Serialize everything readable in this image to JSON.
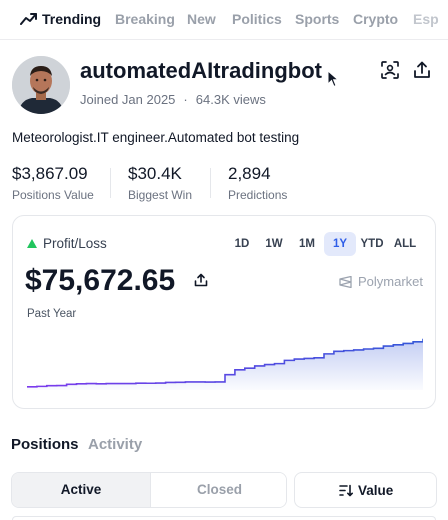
{
  "nav": {
    "items": [
      {
        "label": "Trending",
        "active": true
      },
      {
        "label": "Breaking"
      },
      {
        "label": "New"
      },
      {
        "label": "Politics"
      },
      {
        "label": "Sports"
      },
      {
        "label": "Crypto"
      },
      {
        "label": "Esp"
      }
    ]
  },
  "profile": {
    "username": "automatedAItradingbot",
    "joined": "Joined Jan 2025",
    "views": "64.3K views",
    "bio": "Meteorologist.IT engineer.Automated bot testing",
    "icons": {
      "scan": "scan-profile-icon",
      "share": "share-icon"
    }
  },
  "stats": [
    {
      "value": "$3,867.09",
      "label": "Positions Value"
    },
    {
      "value": "$30.4K",
      "label": "Biggest Win"
    },
    {
      "value": "2,894",
      "label": "Predictions"
    }
  ],
  "pnl": {
    "label": "Profit/Loss",
    "ranges": [
      "1D",
      "1W",
      "1M",
      "1Y",
      "YTD",
      "ALL"
    ],
    "selected_range": "1Y",
    "amount": "$75,672.65",
    "brand": "Polymarket",
    "period": "Past Year",
    "colors": {
      "accent": "#2f5ee8",
      "line_start": "#7c3aed",
      "line_end": "#3558d8",
      "positive": "#22c55e"
    }
  },
  "chart_data": {
    "type": "area",
    "x": [
      0,
      1,
      2,
      3,
      4,
      5,
      6,
      7,
      8,
      9,
      10,
      11,
      12,
      13,
      14,
      15,
      16,
      17,
      18,
      19,
      20,
      21,
      22,
      23,
      24,
      25,
      26,
      27,
      28,
      29,
      30,
      31,
      32,
      33,
      34,
      35,
      36,
      37,
      38,
      39,
      40
    ],
    "values": [
      1.8,
      2.5,
      3.5,
      3.7,
      5.6,
      6.4,
      6.8,
      6.5,
      6.8,
      6.8,
      6.9,
      7.4,
      7.3,
      7.6,
      8.6,
      8.8,
      9.4,
      9.3,
      9.1,
      9.3,
      20.5,
      28.0,
      30.5,
      34.0,
      36.0,
      37.5,
      42.5,
      44.5,
      45.5,
      46.5,
      52.5,
      56.5,
      57.5,
      58.5,
      60.0,
      61.0,
      64.5,
      66.5,
      68.5,
      71.0,
      75.7
    ],
    "ylim": [
      0,
      80
    ],
    "grid": false
  },
  "positions": {
    "tabs": [
      "Positions",
      "Activity"
    ],
    "active_tab": "Positions",
    "filters": [
      "Active",
      "Closed"
    ],
    "active_filter": "Active",
    "sort_label": "Value"
  }
}
